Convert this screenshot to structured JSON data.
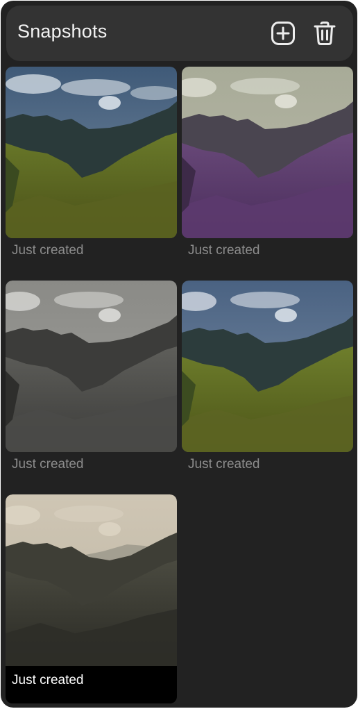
{
  "header": {
    "title": "Snapshots",
    "add_icon": "add-circle-icon",
    "delete_icon": "trash-icon"
  },
  "snapshots": [
    {
      "caption": "Just created",
      "filter": "original"
    },
    {
      "caption": "Just created",
      "filter": "purple-tint"
    },
    {
      "caption": "Just created",
      "filter": "grayscale"
    },
    {
      "caption": "Just created",
      "filter": "vivid"
    },
    {
      "caption": "Just created",
      "filter": "sepia",
      "selected": true
    }
  ],
  "colors": {
    "panel_bg": "#222222",
    "header_bg": "#333333",
    "caption_text": "#8c8c8c",
    "selected_caption_text": "#ffffff"
  }
}
